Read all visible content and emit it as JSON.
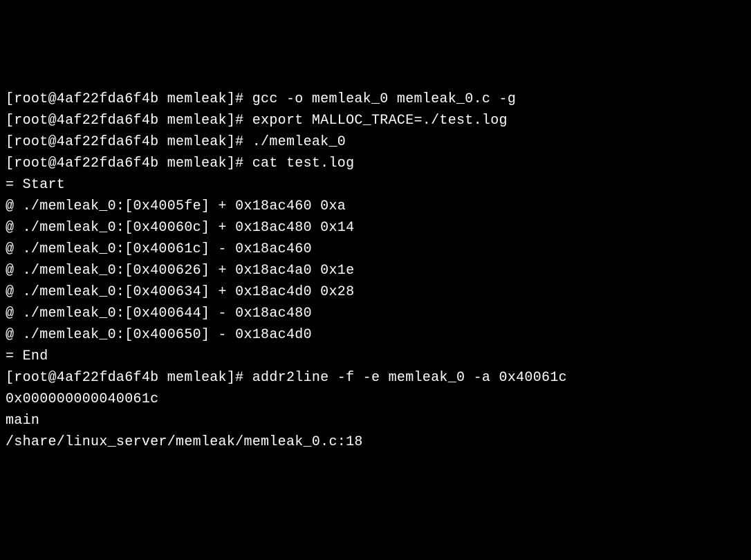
{
  "terminal": {
    "lines": [
      "[root@4af22fda6f4b memleak]# gcc -o memleak_0 memleak_0.c -g",
      "",
      "[root@4af22fda6f4b memleak]# export MALLOC_TRACE=./test.log",
      "[root@4af22fda6f4b memleak]# ./memleak_0",
      "[root@4af22fda6f4b memleak]# cat test.log",
      "",
      "= Start",
      "@ ./memleak_0:[0x4005fe] + 0x18ac460 0xa",
      "@ ./memleak_0:[0x40060c] + 0x18ac480 0x14",
      "@ ./memleak_0:[0x40061c] - 0x18ac460",
      "@ ./memleak_0:[0x400626] + 0x18ac4a0 0x1e",
      "@ ./memleak_0:[0x400634] + 0x18ac4d0 0x28",
      "@ ./memleak_0:[0x400644] - 0x18ac480",
      "@ ./memleak_0:[0x400650] - 0x18ac4d0",
      "= End",
      "[root@4af22fda6f4b memleak]# addr2line -f -e memleak_0 -a 0x40061c",
      "0x000000000040061c",
      "main",
      "/share/linux_server/memleak/memleak_0.c:18"
    ]
  }
}
